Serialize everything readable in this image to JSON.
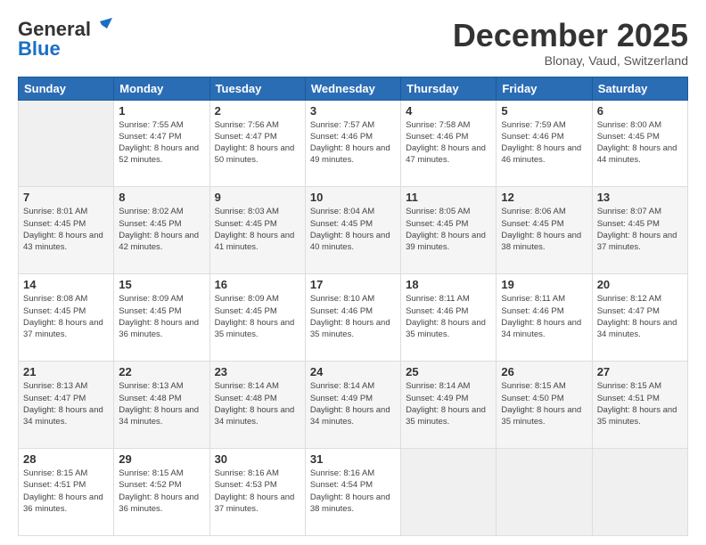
{
  "header": {
    "logo_general": "General",
    "logo_blue": "Blue",
    "month_title": "December 2025",
    "location": "Blonay, Vaud, Switzerland"
  },
  "days_of_week": [
    "Sunday",
    "Monday",
    "Tuesday",
    "Wednesday",
    "Thursday",
    "Friday",
    "Saturday"
  ],
  "weeks": [
    [
      {
        "day": "",
        "sunrise": "",
        "sunset": "",
        "daylight": ""
      },
      {
        "day": "1",
        "sunrise": "Sunrise: 7:55 AM",
        "sunset": "Sunset: 4:47 PM",
        "daylight": "Daylight: 8 hours and 52 minutes."
      },
      {
        "day": "2",
        "sunrise": "Sunrise: 7:56 AM",
        "sunset": "Sunset: 4:47 PM",
        "daylight": "Daylight: 8 hours and 50 minutes."
      },
      {
        "day": "3",
        "sunrise": "Sunrise: 7:57 AM",
        "sunset": "Sunset: 4:46 PM",
        "daylight": "Daylight: 8 hours and 49 minutes."
      },
      {
        "day": "4",
        "sunrise": "Sunrise: 7:58 AM",
        "sunset": "Sunset: 4:46 PM",
        "daylight": "Daylight: 8 hours and 47 minutes."
      },
      {
        "day": "5",
        "sunrise": "Sunrise: 7:59 AM",
        "sunset": "Sunset: 4:46 PM",
        "daylight": "Daylight: 8 hours and 46 minutes."
      },
      {
        "day": "6",
        "sunrise": "Sunrise: 8:00 AM",
        "sunset": "Sunset: 4:45 PM",
        "daylight": "Daylight: 8 hours and 44 minutes."
      }
    ],
    [
      {
        "day": "7",
        "sunrise": "Sunrise: 8:01 AM",
        "sunset": "Sunset: 4:45 PM",
        "daylight": "Daylight: 8 hours and 43 minutes."
      },
      {
        "day": "8",
        "sunrise": "Sunrise: 8:02 AM",
        "sunset": "Sunset: 4:45 PM",
        "daylight": "Daylight: 8 hours and 42 minutes."
      },
      {
        "day": "9",
        "sunrise": "Sunrise: 8:03 AM",
        "sunset": "Sunset: 4:45 PM",
        "daylight": "Daylight: 8 hours and 41 minutes."
      },
      {
        "day": "10",
        "sunrise": "Sunrise: 8:04 AM",
        "sunset": "Sunset: 4:45 PM",
        "daylight": "Daylight: 8 hours and 40 minutes."
      },
      {
        "day": "11",
        "sunrise": "Sunrise: 8:05 AM",
        "sunset": "Sunset: 4:45 PM",
        "daylight": "Daylight: 8 hours and 39 minutes."
      },
      {
        "day": "12",
        "sunrise": "Sunrise: 8:06 AM",
        "sunset": "Sunset: 4:45 PM",
        "daylight": "Daylight: 8 hours and 38 minutes."
      },
      {
        "day": "13",
        "sunrise": "Sunrise: 8:07 AM",
        "sunset": "Sunset: 4:45 PM",
        "daylight": "Daylight: 8 hours and 37 minutes."
      }
    ],
    [
      {
        "day": "14",
        "sunrise": "Sunrise: 8:08 AM",
        "sunset": "Sunset: 4:45 PM",
        "daylight": "Daylight: 8 hours and 37 minutes."
      },
      {
        "day": "15",
        "sunrise": "Sunrise: 8:09 AM",
        "sunset": "Sunset: 4:45 PM",
        "daylight": "Daylight: 8 hours and 36 minutes."
      },
      {
        "day": "16",
        "sunrise": "Sunrise: 8:09 AM",
        "sunset": "Sunset: 4:45 PM",
        "daylight": "Daylight: 8 hours and 35 minutes."
      },
      {
        "day": "17",
        "sunrise": "Sunrise: 8:10 AM",
        "sunset": "Sunset: 4:46 PM",
        "daylight": "Daylight: 8 hours and 35 minutes."
      },
      {
        "day": "18",
        "sunrise": "Sunrise: 8:11 AM",
        "sunset": "Sunset: 4:46 PM",
        "daylight": "Daylight: 8 hours and 35 minutes."
      },
      {
        "day": "19",
        "sunrise": "Sunrise: 8:11 AM",
        "sunset": "Sunset: 4:46 PM",
        "daylight": "Daylight: 8 hours and 34 minutes."
      },
      {
        "day": "20",
        "sunrise": "Sunrise: 8:12 AM",
        "sunset": "Sunset: 4:47 PM",
        "daylight": "Daylight: 8 hours and 34 minutes."
      }
    ],
    [
      {
        "day": "21",
        "sunrise": "Sunrise: 8:13 AM",
        "sunset": "Sunset: 4:47 PM",
        "daylight": "Daylight: 8 hours and 34 minutes."
      },
      {
        "day": "22",
        "sunrise": "Sunrise: 8:13 AM",
        "sunset": "Sunset: 4:48 PM",
        "daylight": "Daylight: 8 hours and 34 minutes."
      },
      {
        "day": "23",
        "sunrise": "Sunrise: 8:14 AM",
        "sunset": "Sunset: 4:48 PM",
        "daylight": "Daylight: 8 hours and 34 minutes."
      },
      {
        "day": "24",
        "sunrise": "Sunrise: 8:14 AM",
        "sunset": "Sunset: 4:49 PM",
        "daylight": "Daylight: 8 hours and 34 minutes."
      },
      {
        "day": "25",
        "sunrise": "Sunrise: 8:14 AM",
        "sunset": "Sunset: 4:49 PM",
        "daylight": "Daylight: 8 hours and 35 minutes."
      },
      {
        "day": "26",
        "sunrise": "Sunrise: 8:15 AM",
        "sunset": "Sunset: 4:50 PM",
        "daylight": "Daylight: 8 hours and 35 minutes."
      },
      {
        "day": "27",
        "sunrise": "Sunrise: 8:15 AM",
        "sunset": "Sunset: 4:51 PM",
        "daylight": "Daylight: 8 hours and 35 minutes."
      }
    ],
    [
      {
        "day": "28",
        "sunrise": "Sunrise: 8:15 AM",
        "sunset": "Sunset: 4:51 PM",
        "daylight": "Daylight: 8 hours and 36 minutes."
      },
      {
        "day": "29",
        "sunrise": "Sunrise: 8:15 AM",
        "sunset": "Sunset: 4:52 PM",
        "daylight": "Daylight: 8 hours and 36 minutes."
      },
      {
        "day": "30",
        "sunrise": "Sunrise: 8:16 AM",
        "sunset": "Sunset: 4:53 PM",
        "daylight": "Daylight: 8 hours and 37 minutes."
      },
      {
        "day": "31",
        "sunrise": "Sunrise: 8:16 AM",
        "sunset": "Sunset: 4:54 PM",
        "daylight": "Daylight: 8 hours and 38 minutes."
      },
      {
        "day": "",
        "sunrise": "",
        "sunset": "",
        "daylight": ""
      },
      {
        "day": "",
        "sunrise": "",
        "sunset": "",
        "daylight": ""
      },
      {
        "day": "",
        "sunrise": "",
        "sunset": "",
        "daylight": ""
      }
    ]
  ]
}
